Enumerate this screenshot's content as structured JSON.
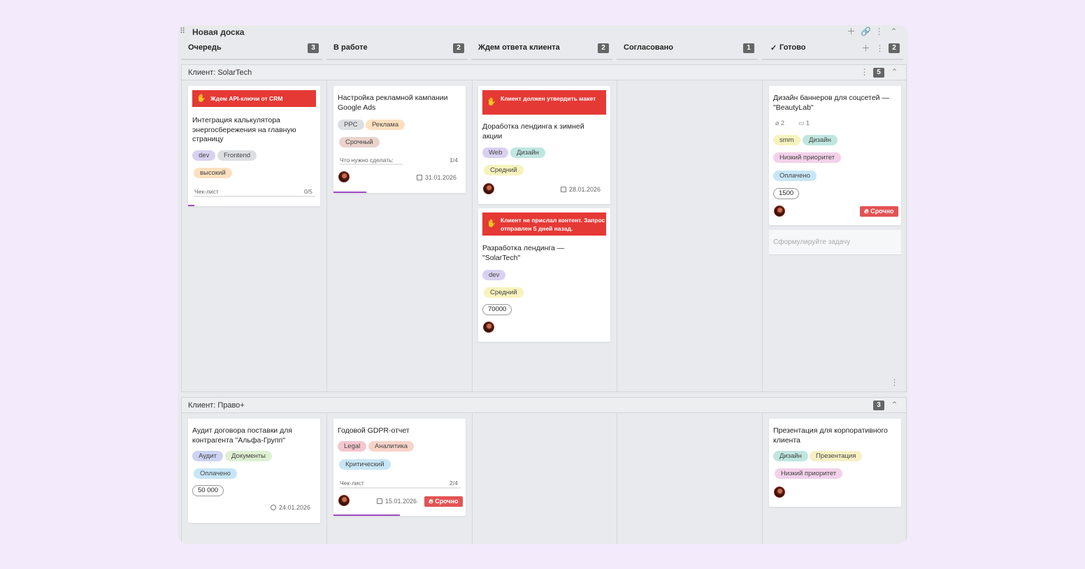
{
  "board": {
    "title": "Новая доска",
    "actions": [
      "plus-icon",
      "link-icon",
      "more-vert-icon",
      "chevron-up-icon"
    ]
  },
  "columns": [
    {
      "name": "Очередь",
      "count": "3"
    },
    {
      "name": "В работе",
      "count": "2"
    },
    {
      "name": "Ждем ответа клиента",
      "count": "2"
    },
    {
      "name": "Согласовано",
      "count": "1"
    },
    {
      "name": "Готово",
      "count": "2",
      "check": "✓"
    }
  ],
  "lanes": [
    {
      "title": "Клиент: SolarTech",
      "count": "5",
      "cards": {
        "c1": {
          "banner": "Ждем API-ключи от CRM",
          "title": "Интеграция калькулятора энергосбережения на главную страницу",
          "tags": [
            "dev",
            "Frontend",
            "высокий"
          ],
          "checklist_label": "Чек-лист",
          "checklist_count": "0/5",
          "progress": 0.05
        },
        "c2": {
          "title": "Настройка рекламной кампании Google Ads",
          "tags": [
            "PPC",
            "Реклама",
            "Срочный"
          ],
          "checklist_label": "Что нужно сделать:",
          "checklist_count": "1/4",
          "progress": 0.25,
          "date": "31.01.2026"
        },
        "c3": {
          "banner": "Клиент должен утвердить макет",
          "title": "Доработка лендинга к зимней акции",
          "tags": [
            "Web",
            "Дизайн",
            "Средний"
          ],
          "date": "28.01.2026"
        },
        "c4": {
          "banner": "Клиент не прислал контент. Запрос отправлен 5 дней назад.",
          "title": "Разработка лендинга — \"SolarTech\"",
          "tags": [
            "dev",
            "Средний"
          ],
          "amount": "70000"
        },
        "c5": {
          "title": "Дизайн баннеров для соцсетей — \"BeautyLab\"",
          "attachments": "2",
          "comments": "1",
          "tags": [
            "smm",
            "Дизайн",
            "Низкий приоритет",
            "Оплачено"
          ],
          "amount": "1500",
          "urgent": "Срочно"
        }
      },
      "placeholder": "Сформулируйте задачу"
    },
    {
      "title": "Клиент: Право+",
      "count": "3",
      "cards": {
        "c1": {
          "title": "Аудит договора поставки для контрагента \"Альфа-Групп\"",
          "tags": [
            "Аудит",
            "Документы",
            "Оплачено"
          ],
          "amount": "50 000",
          "date": "24.01.2026"
        },
        "c2": {
          "title": "Годовой GDPR-отчет",
          "tags": [
            "Legal",
            "Аналитика",
            "Критический"
          ],
          "checklist_label": "Чек-лист",
          "checklist_count": "2/4",
          "progress": 0.5,
          "date": "15.01.2026",
          "urgent": "Срочно"
        },
        "c3": {
          "title": "Презентация для корпоративного клиента",
          "tags": [
            "Дизайн",
            "Презентация",
            "Низкий приоритет"
          ]
        }
      }
    }
  ],
  "tag_colors": {
    "purple": "#d9d1f0",
    "grey": "#dcdfe2",
    "orange": "#fde0bf",
    "brown": "#e9d3cd",
    "yellow": "#f7f3bd",
    "teal": "#bfe6df",
    "pink": "#f3d1ea",
    "blue": "#c7e6f7",
    "green": "#dff0d3",
    "rose": "#f6c6cf",
    "salmon": "#f8d3c8",
    "lavender": "#cdd3f3",
    "cream": "#f8f0c4"
  },
  "banner_color": "#e53935",
  "urgent_color": "#e35353",
  "progress_color": "#a14ac4"
}
